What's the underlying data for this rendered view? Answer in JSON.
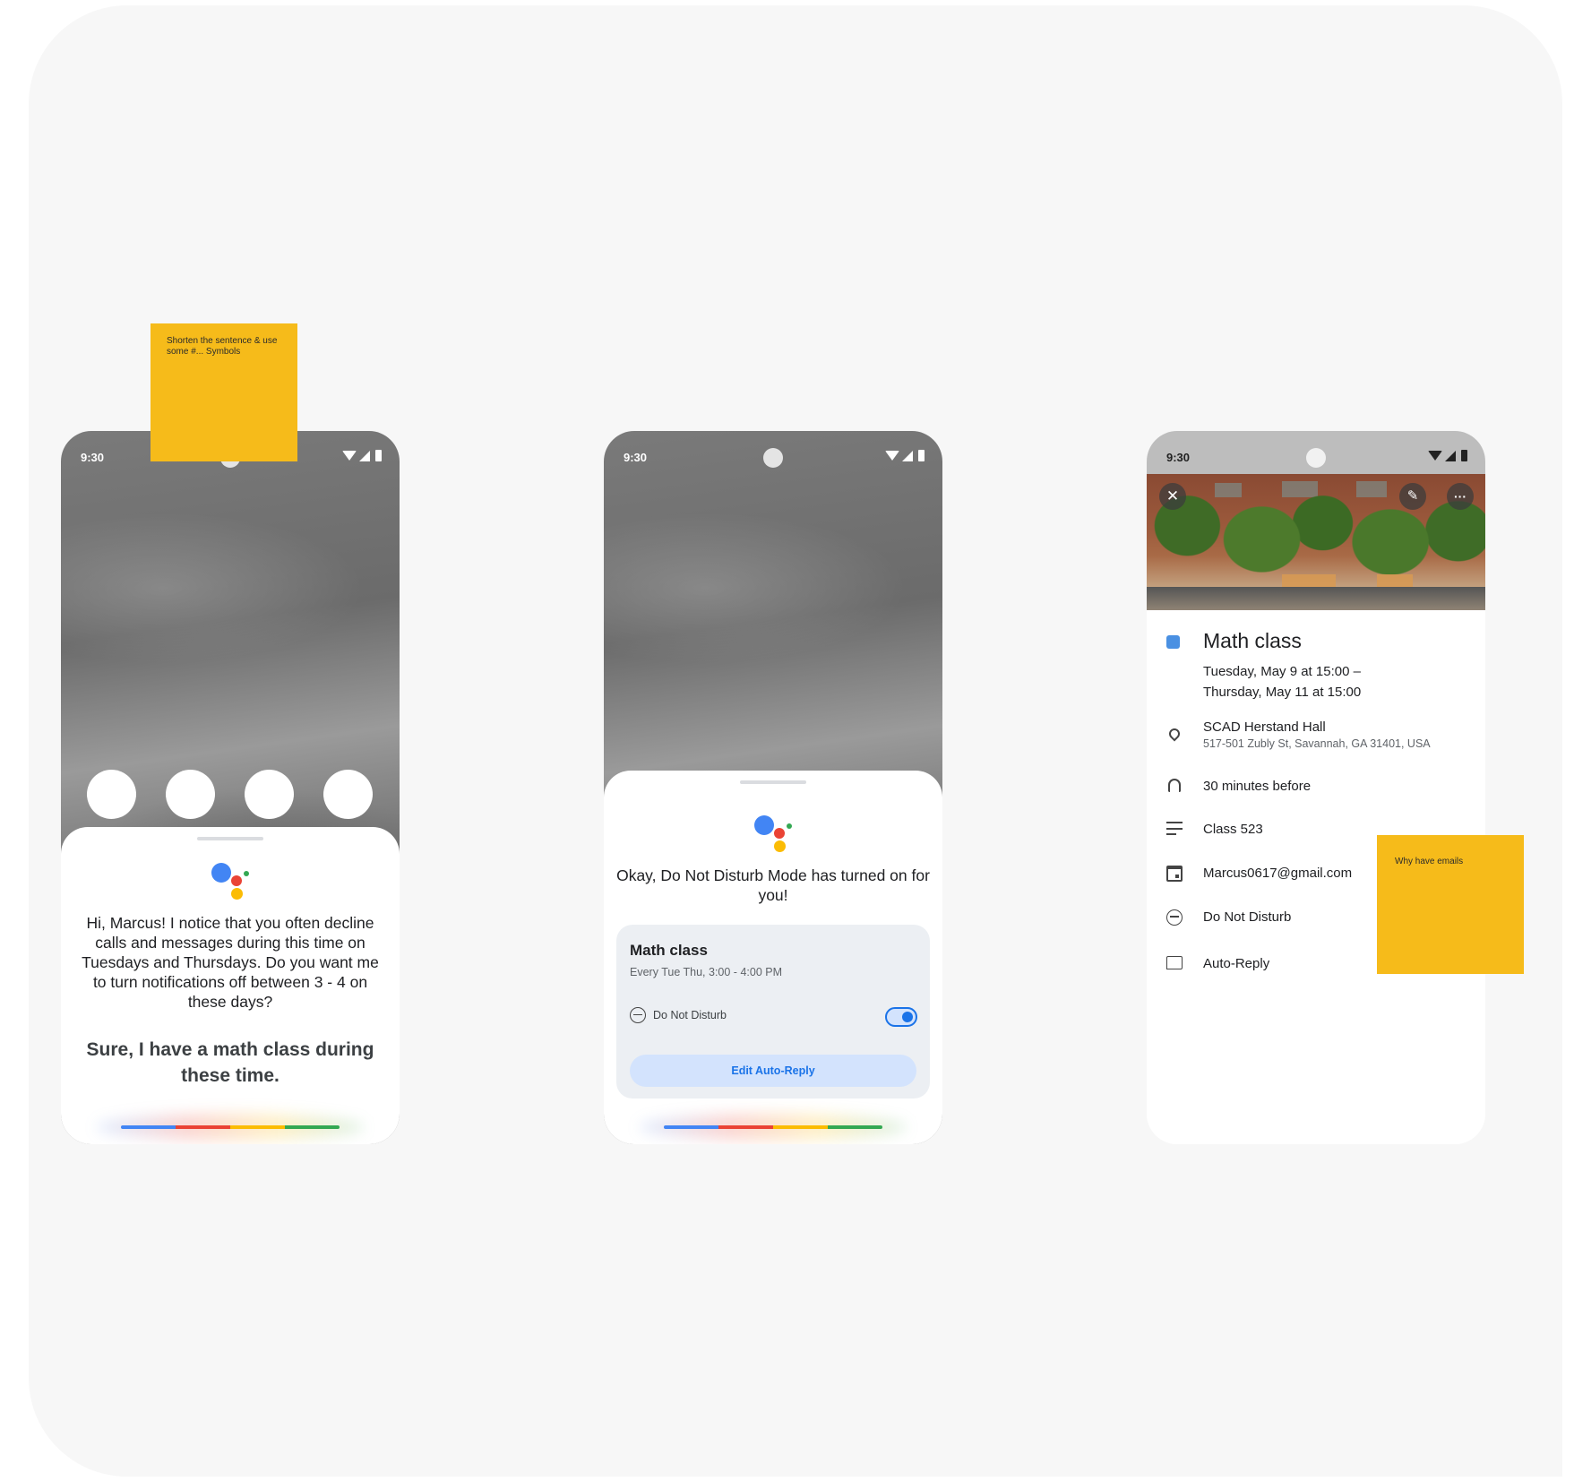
{
  "status_time": "9:30",
  "screen1": {
    "assistant_message": "Hi, Marcus! I notice that you often decline calls and messages during this time on Tuesdays and Thursdays. Do you want me to turn notifications off between 3 - 4 on these days?",
    "user_reply": "Sure, I have a math class during these time."
  },
  "screen2": {
    "assistant_message": "Okay, Do Not Disturb Mode has turned on for you!",
    "card": {
      "title": "Math class",
      "schedule": "Every Tue Thu, 3:00 - 4:00 PM",
      "dnd_label": "Do Not Disturb",
      "toggle_on": true,
      "edit_button": "Edit Auto-Reply"
    }
  },
  "screen3": {
    "event_title": "Math class",
    "event_color": "#4a90e2",
    "date_line1": "Tuesday, May 9 at 15:00 –",
    "date_line2": "Thursday, May 11 at 15:00",
    "location_name": "SCAD Herstand Hall",
    "location_address": "517-501 Zubly St, Savannah, GA 31401, USA",
    "reminder": "30 minutes before",
    "description": "Class 523",
    "calendar_account": "Marcus0617@gmail.com",
    "dnd_label": "Do Not Disturb",
    "auto_reply_label": "Auto-Reply",
    "icons": [
      "close-icon",
      "edit-icon",
      "more-icon",
      "location-pin-icon",
      "bell-icon",
      "notes-icon",
      "calendar-icon",
      "do-not-disturb-icon",
      "auto-reply-icon"
    ]
  },
  "sticky_notes": {
    "note1": "Shorten the sentence & use some #... Symbols",
    "note2": "Why have emails",
    "color": "#f6bb1a"
  }
}
